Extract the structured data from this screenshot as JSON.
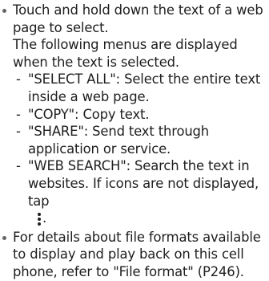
{
  "bullets": [
    {
      "lines": [
        "Touch and hold down the text of a web page to select.",
        "The following menus are displayed when the text is selected."
      ],
      "sub_items": [
        {
          "dash": "-",
          "text": "\"SELECT ALL\": Select the entire text inside a web page."
        },
        {
          "dash": "-",
          "text": "\"COPY\": Copy text."
        },
        {
          "dash": "-",
          "text": "\"SHARE\": Send text through application or service."
        },
        {
          "dash": "-",
          "text": "\"WEB SEARCH\": Search the text in websites. If icons are not displayed, tap",
          "icon": "more-vertical-icon",
          "suffix": "."
        }
      ]
    },
    {
      "lines": [
        "For details about file formats available to display and play back on this cell phone, refer to \"File format\" (P246)."
      ]
    }
  ]
}
